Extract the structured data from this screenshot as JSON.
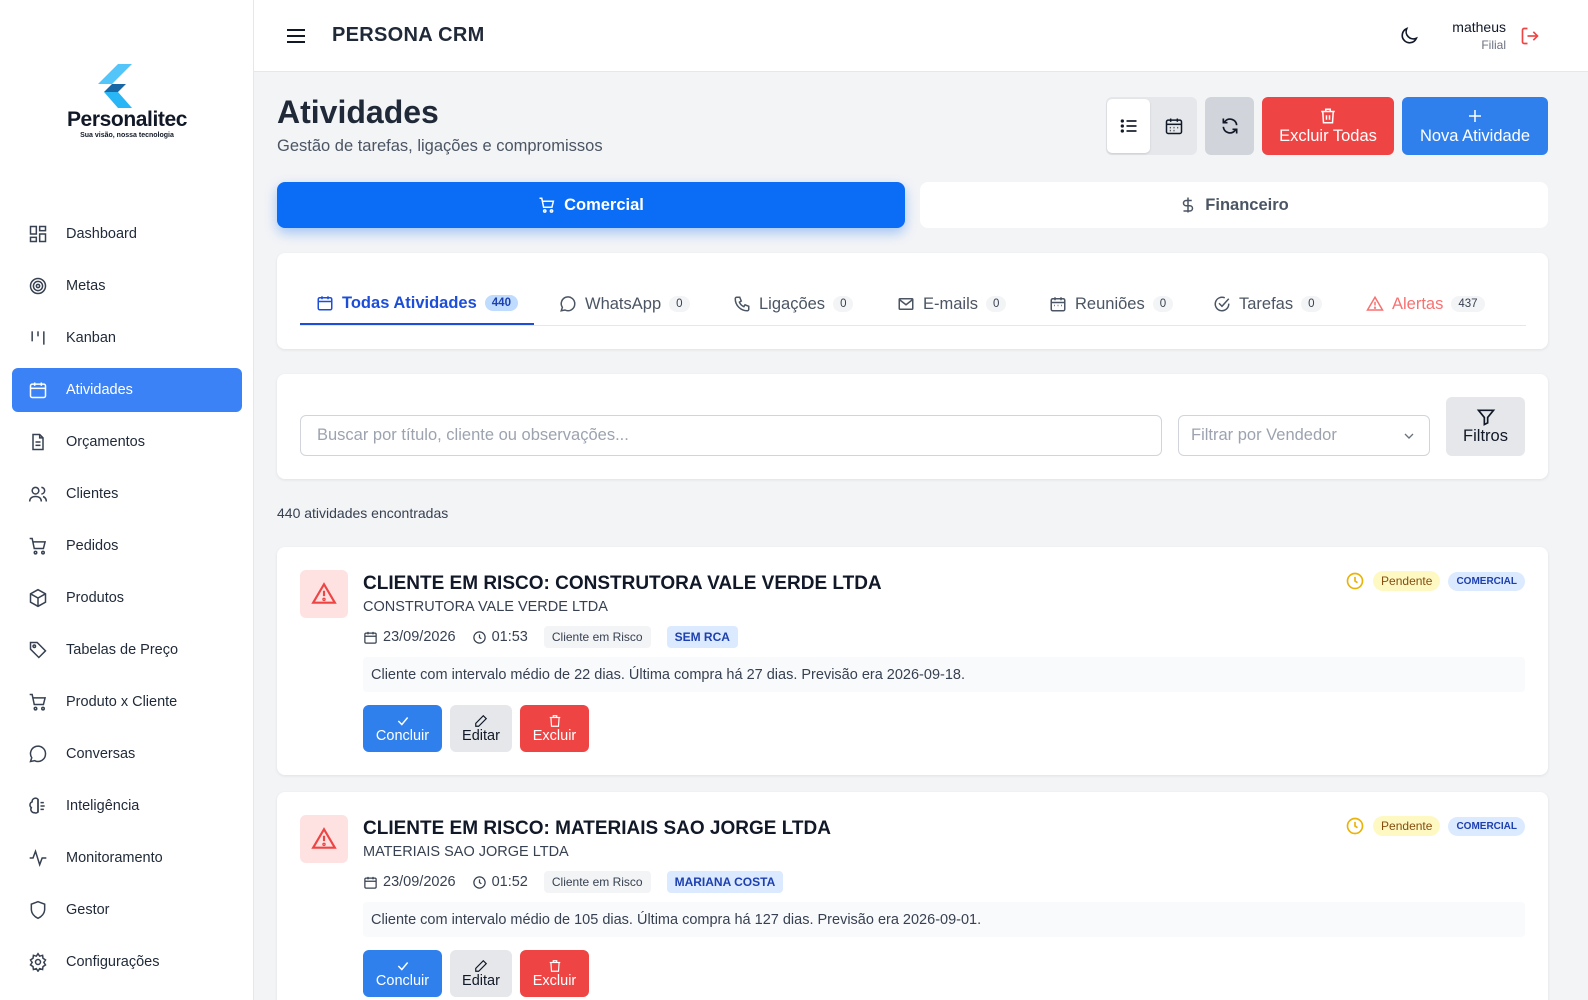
{
  "sidebar": {
    "brand": "Personalitec",
    "tagline": "Sua visão, nossa tecnologia",
    "items": [
      {
        "label": "Dashboard",
        "icon": "dashboard-icon"
      },
      {
        "label": "Metas",
        "icon": "target-icon"
      },
      {
        "label": "Kanban",
        "icon": "kanban-icon"
      },
      {
        "label": "Atividades",
        "icon": "calendar-icon",
        "active": true
      },
      {
        "label": "Orçamentos",
        "icon": "file-text-icon"
      },
      {
        "label": "Clientes",
        "icon": "users-icon"
      },
      {
        "label": "Pedidos",
        "icon": "cart-icon"
      },
      {
        "label": "Produtos",
        "icon": "package-icon"
      },
      {
        "label": "Tabelas de Preço",
        "icon": "tag-icon"
      },
      {
        "label": "Produto x Cliente",
        "icon": "cart-icon"
      },
      {
        "label": "Conversas",
        "icon": "chat-icon"
      },
      {
        "label": "Inteligência",
        "icon": "brain-icon"
      },
      {
        "label": "Monitoramento",
        "icon": "activity-icon"
      },
      {
        "label": "Gestor",
        "icon": "shield-icon"
      },
      {
        "label": "Configurações",
        "icon": "gear-icon"
      }
    ]
  },
  "header": {
    "title": "PERSONA CRM",
    "user_name": "matheus",
    "user_role": "Filial"
  },
  "page": {
    "title": "Atividades",
    "subtitle": "Gestão de tarefas, ligações e compromissos",
    "delete_all_label": "Excluir Todas",
    "new_label": "Nova Atividade"
  },
  "segments": {
    "comercial": "Comercial",
    "financeiro": "Financeiro"
  },
  "tabs": [
    {
      "label": "Todas Atividades",
      "count": "440",
      "icon": "calendar-icon"
    },
    {
      "label": "WhatsApp",
      "count": "0",
      "icon": "chat-icon"
    },
    {
      "label": "Ligações",
      "count": "0",
      "icon": "phone-icon"
    },
    {
      "label": "E-mails",
      "count": "0",
      "icon": "mail-icon"
    },
    {
      "label": "Reuniões",
      "count": "0",
      "icon": "calendar-icon"
    },
    {
      "label": "Tarefas",
      "count": "0",
      "icon": "check-circle-icon"
    },
    {
      "label": "Alertas",
      "count": "437",
      "icon": "warning-icon"
    }
  ],
  "filters": {
    "search_placeholder": "Buscar por título, cliente ou observações...",
    "vendor_placeholder": "Filtrar por Vendedor",
    "filters_label": "Filtros"
  },
  "results": {
    "count_text": "440 atividades encontradas"
  },
  "activities": [
    {
      "title": "CLIENTE EM RISCO: CONSTRUTORA VALE VERDE LTDA",
      "client": "CONSTRUTORA VALE VERDE LTDA",
      "date": "23/09/2026",
      "time": "01:53",
      "type": "Cliente em Risco",
      "seller": "SEM RCA",
      "notes": "Cliente com intervalo médio de 22 dias. Última compra há 27 dias. Previsão era 2026-09-18.",
      "status": "Pendente",
      "category": "COMERCIAL"
    },
    {
      "title": "CLIENTE EM RISCO: MATERIAIS SAO JORGE LTDA",
      "client": "MATERIAIS SAO JORGE LTDA",
      "date": "23/09/2026",
      "time": "01:52",
      "type": "Cliente em Risco",
      "seller": "MARIANA COSTA",
      "notes": "Cliente com intervalo médio de 105 dias. Última compra há 127 dias. Previsão era 2026-09-01.",
      "status": "Pendente",
      "category": "COMERCIAL"
    }
  ],
  "actions": {
    "complete": "Concluir",
    "edit": "Editar",
    "delete": "Excluir"
  },
  "colors": {
    "primary": "#2f80ed",
    "segment_active": "#0b6cf5",
    "danger": "#ef4444",
    "warning": "#eab308"
  }
}
